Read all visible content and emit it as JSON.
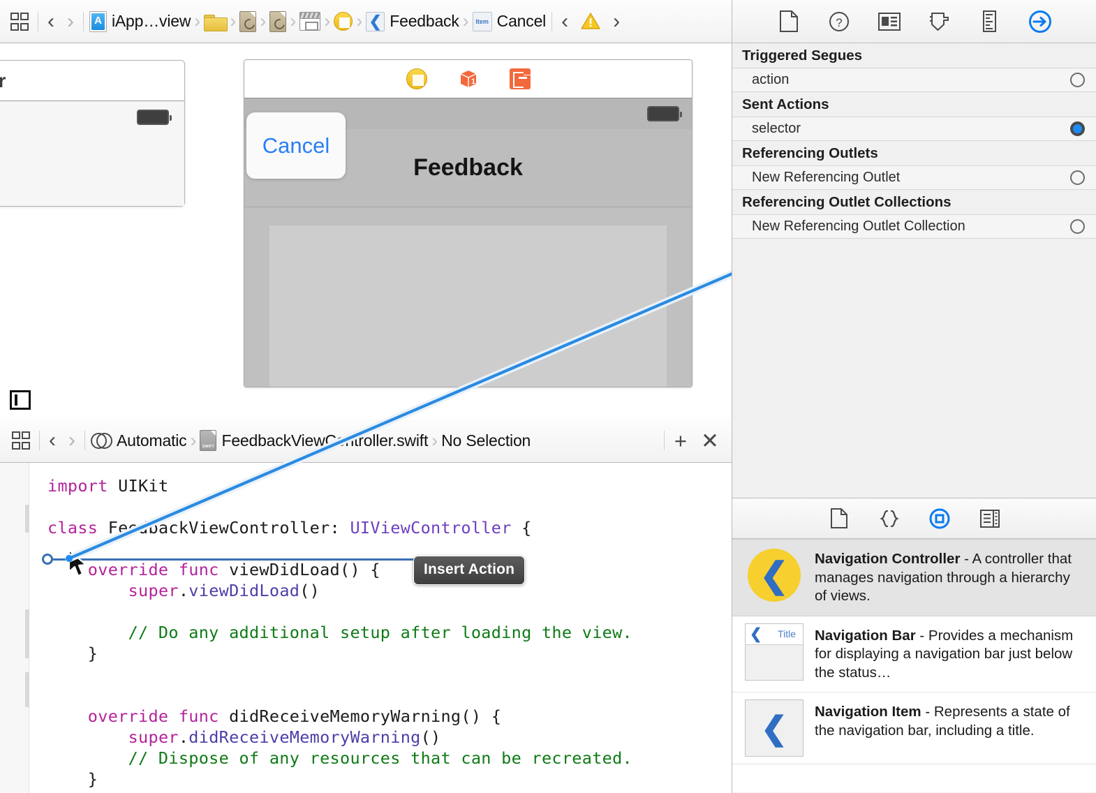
{
  "ib_jumpbar": {
    "related_items_icon": "related-items-icon",
    "back_label": "‹",
    "forward_label": "›",
    "breadcrumbs": [
      {
        "label": "iApp…view",
        "icon": "app-project-icon"
      },
      {
        "label": "",
        "icon": "folder-icon"
      },
      {
        "label": "",
        "icon": "source-file-icon"
      },
      {
        "label": "",
        "icon": "source-file-icon"
      },
      {
        "label": "",
        "icon": "storyboard-icon"
      },
      {
        "label": "",
        "icon": "view-controller-icon"
      },
      {
        "label": "Feedback",
        "icon": "navigation-item-icon"
      },
      {
        "label": "Cancel",
        "icon": "bar-button-item-icon"
      }
    ],
    "issue_prev": "‹",
    "issue_next": "›",
    "issue_icon": "warning-triangle-icon"
  },
  "canvas": {
    "left_scene_title": "troller",
    "dock_icons": [
      "view-controller-icon",
      "first-responder-icon",
      "exit-icon"
    ],
    "sim": {
      "cancel_button": "Cancel",
      "title": "Feedback",
      "battery_icon": "battery-icon"
    },
    "filter_button": "canvas-filter-button"
  },
  "editor_jumpbar": {
    "related_items_icon": "related-items-icon",
    "back_label": "‹",
    "forward_label": "›",
    "scheme": "Automatic",
    "file": "FeedbackViewController.swift",
    "selection": "No Selection",
    "add_editor": "+",
    "close_editor": "✕"
  },
  "code": {
    "lines": [
      {
        "segments": [
          {
            "t": "import",
            "c": "kw"
          },
          {
            "t": " UIKit",
            "c": "fn"
          }
        ]
      },
      {
        "segments": []
      },
      {
        "segments": [
          {
            "t": "class",
            "c": "kw"
          },
          {
            "t": " FeedbackViewController: ",
            "c": "fn"
          },
          {
            "t": "UIViewController",
            "c": "typ"
          },
          {
            "t": " {",
            "c": "fn"
          }
        ]
      },
      {
        "segments": []
      },
      {
        "segments": [
          {
            "t": "    ",
            "c": "fn"
          },
          {
            "t": "override func",
            "c": "kw"
          },
          {
            "t": " viewDidLoad() {",
            "c": "fn"
          }
        ]
      },
      {
        "segments": [
          {
            "t": "        ",
            "c": "fn"
          },
          {
            "t": "super",
            "c": "kw"
          },
          {
            "t": ".",
            "c": "fn"
          },
          {
            "t": "viewDidLoad",
            "c": "mem"
          },
          {
            "t": "()",
            "c": "fn"
          }
        ]
      },
      {
        "segments": []
      },
      {
        "segments": [
          {
            "t": "        // Do any additional setup after loading the view.",
            "c": "cmt"
          }
        ]
      },
      {
        "segments": [
          {
            "t": "    }",
            "c": "fn"
          }
        ]
      },
      {
        "segments": []
      },
      {
        "segments": []
      },
      {
        "segments": [
          {
            "t": "    ",
            "c": "fn"
          },
          {
            "t": "override func",
            "c": "kw"
          },
          {
            "t": " didReceiveMemoryWarning() {",
            "c": "fn"
          }
        ]
      },
      {
        "segments": [
          {
            "t": "        ",
            "c": "fn"
          },
          {
            "t": "super",
            "c": "kw"
          },
          {
            "t": ".",
            "c": "fn"
          },
          {
            "t": "didReceiveMemoryWarning",
            "c": "mem"
          },
          {
            "t": "()",
            "c": "fn"
          }
        ]
      },
      {
        "segments": [
          {
            "t": "        // Dispose of any resources that can be recreated.",
            "c": "cmt"
          }
        ]
      },
      {
        "segments": [
          {
            "t": "    }",
            "c": "fn"
          }
        ]
      }
    ],
    "tooltip": "Insert Action"
  },
  "inspector": {
    "toolbar_icons": [
      "file-inspector-icon",
      "quick-help-inspector-icon",
      "identity-inspector-icon",
      "attributes-inspector-icon",
      "size-inspector-icon",
      "connections-inspector-icon"
    ],
    "active_toolbar_index": 5,
    "sections": [
      {
        "title": "Triggered Segues",
        "rows": [
          {
            "label": "action",
            "connected": false
          }
        ]
      },
      {
        "title": "Sent Actions",
        "rows": [
          {
            "label": "selector",
            "connected": true
          }
        ]
      },
      {
        "title": "Referencing Outlets",
        "rows": [
          {
            "label": "New Referencing Outlet",
            "connected": false
          }
        ]
      },
      {
        "title": "Referencing Outlet Collections",
        "rows": [
          {
            "label": "New Referencing Outlet Collection",
            "connected": false
          }
        ]
      }
    ]
  },
  "library": {
    "toolbar_icons": [
      "file-template-library-icon",
      "code-snippet-library-icon",
      "object-library-icon",
      "media-library-icon"
    ],
    "active_toolbar_index": 2,
    "items": [
      {
        "thumb": "navigation-controller-thumb",
        "name": "Navigation Controller",
        "description": " - A controller that manages navigation through a hierarchy of views.",
        "selected": true
      },
      {
        "thumb": "navigation-bar-thumb",
        "thumb_title": "Title",
        "name": "Navigation Bar",
        "description": " - Provides a mechanism for displaying a navigation bar just below the status…",
        "selected": false
      },
      {
        "thumb": "navigation-item-thumb",
        "name": "Navigation Item",
        "description": " - Represents a state of the navigation bar, including a title.",
        "selected": false
      }
    ]
  },
  "colors": {
    "accent_blue": "#1e8cf5",
    "connection_line": "#2a8ae0",
    "warning_yellow": "#f4c020",
    "exit_orange": "#f2693c"
  }
}
